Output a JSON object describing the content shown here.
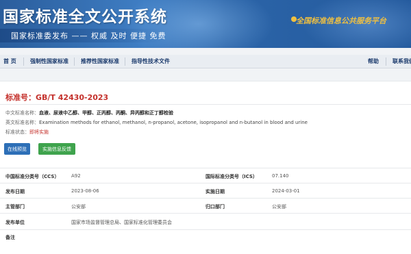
{
  "header": {
    "title": "国家标准全文公开系统",
    "subtitle": "国家标准委发布 —— 权威 及时 便捷 免费",
    "platform": "全国标准信息公共服务平台"
  },
  "nav": {
    "items": [
      "首 页",
      "强制性国家标准",
      "推荐性国家标准",
      "指导性技术文件",
      "帮助",
      "联系我们"
    ]
  },
  "standard": {
    "number": "标准号：GB/T 42430-2023",
    "cn_name_label": "中文标准名称：",
    "cn_name": "血液、尿液中乙醇、甲醇、正丙醇、丙酮、异丙醇和正丁醇检验",
    "en_name_label": "英文标准名称：",
    "en_name": "Examination methods for ethanol, methanol, n-propanol, acetone, isopropanol and n-butanol in blood and urine",
    "status_label": "标准状态：",
    "status": "即将实施"
  },
  "buttons": {
    "preview": "在线预览",
    "feedback": "实施信息反馈"
  },
  "details": {
    "ccs_label": "中国标准分类号（CCS）",
    "ccs": "A92",
    "ics_label": "国际标准分类号（ICS）",
    "ics": "07.140",
    "publish_label": "发布日期",
    "publish": "2023-08-06",
    "implement_label": "实施日期",
    "implement": "2024-03-01",
    "admin_label": "主管部门",
    "admin": "公安部",
    "owner_label": "归口部门",
    "owner": "公安部",
    "issuer_label": "发布单位",
    "issuer": "国家市场监督管理总局、国家标准化管理委员会",
    "remarks_label": "备注"
  }
}
